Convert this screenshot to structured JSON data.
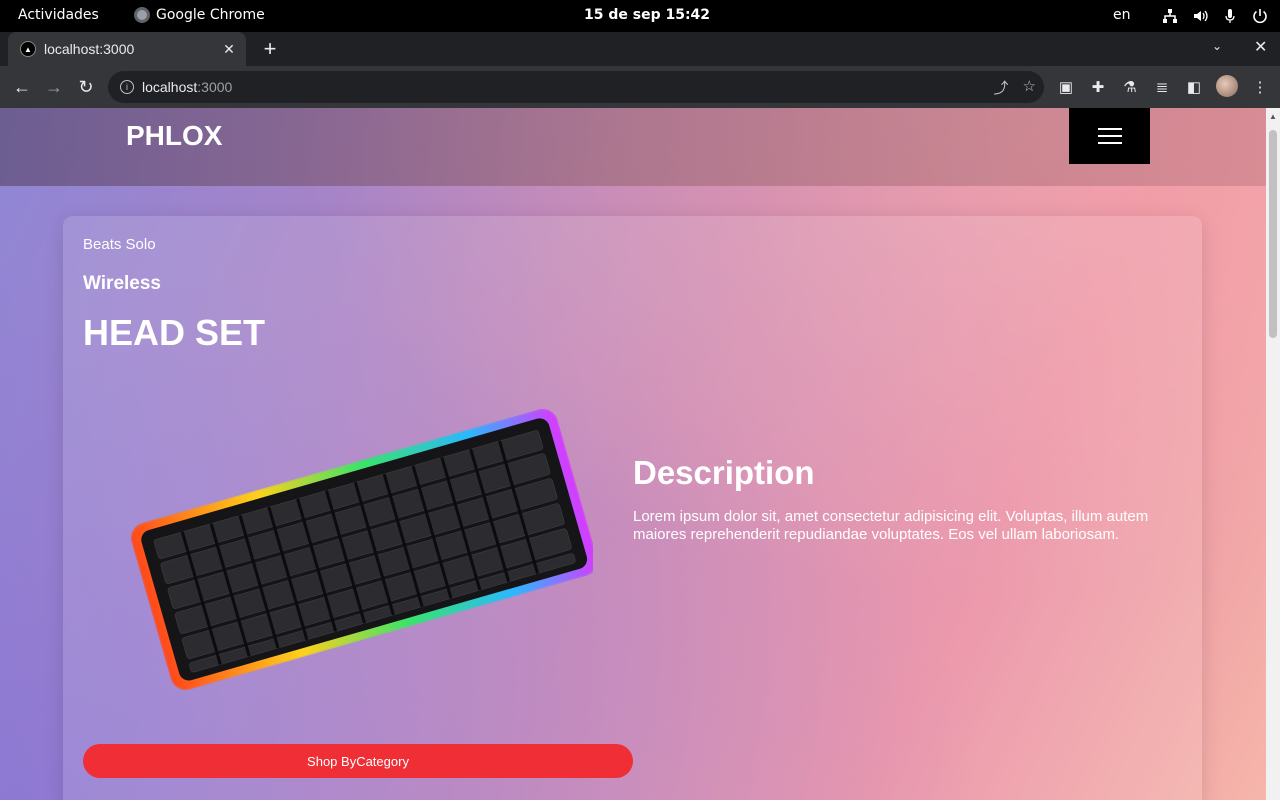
{
  "system": {
    "activities": "Actividades",
    "app_name": "Google Chrome",
    "clock": "15 de sep  15:42",
    "language": "en"
  },
  "browser": {
    "tab_title": "localhost:3000",
    "url_host": "localhost",
    "url_port": ":3000"
  },
  "page": {
    "brand": "PHLOX",
    "hero": {
      "subtitle": "Beats Solo",
      "subheading": "Wireless",
      "headline": "HEAD SET",
      "description_title": "Description",
      "description_text": "Lorem ipsum dolor sit, amet consectetur adipisicing elit. Voluptas, illum autem maiores reprehenderit repudiandae voluptates. Eos vel ullam laboriosam.",
      "cta_label": "Shop ByCategory"
    }
  },
  "colors": {
    "cta": "#ef2e35",
    "menu_button": "#000000"
  }
}
